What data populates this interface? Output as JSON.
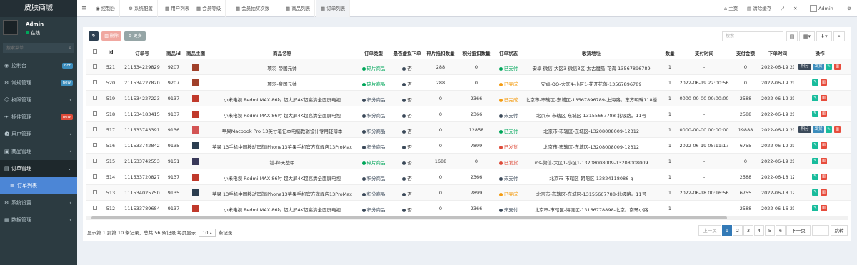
{
  "app": {
    "title": "皮肤商城"
  },
  "user": {
    "name": "Admin",
    "status": "在线"
  },
  "sidebar": {
    "search_placeholder": "搜索菜单",
    "items": [
      {
        "label": "控制台",
        "icon": "dashboard-icon",
        "badge": "hot",
        "badge_color": "#3c8dbc"
      },
      {
        "label": "常规管理",
        "icon": "cog-icon",
        "badge": "new",
        "badge_color": "#3c8dbc"
      },
      {
        "label": "权限管理",
        "icon": "users-icon",
        "arrow": "‹"
      },
      {
        "label": "插件管理",
        "icon": "rocket-icon",
        "badge": "new",
        "badge_color": "#dd4b39"
      },
      {
        "label": "用户管理",
        "icon": "user-icon",
        "arrow": "‹"
      },
      {
        "label": "商品管理",
        "icon": "goods-icon",
        "arrow": "‹"
      },
      {
        "label": "订单管理",
        "icon": "order-icon",
        "arrow": "⌄"
      },
      {
        "label": "订单列表",
        "icon": "list-icon"
      },
      {
        "label": "系统设置",
        "icon": "settings-icon",
        "arrow": "‹"
      },
      {
        "label": "数据管理",
        "icon": "database-icon",
        "arrow": "‹"
      }
    ]
  },
  "topbar": {
    "menu_icon": "≡",
    "tabs": [
      {
        "label": "控制台",
        "icon": "◉"
      },
      {
        "label": "系统配置",
        "icon": "⚙"
      },
      {
        "label": "用户列表",
        "icon": "▦"
      },
      {
        "label": "会员等级",
        "icon": "▦"
      },
      {
        "label": "会员抽奖次数",
        "icon": "▦"
      },
      {
        "label": "商品列表",
        "icon": "▦"
      },
      {
        "label": "订单列表",
        "icon": "▦"
      }
    ],
    "home": "主页",
    "clear_cache": "清除缓存",
    "admin": "Admin"
  },
  "toolbar": {
    "delete": "删除",
    "more": "更多",
    "search_placeholder": "搜索"
  },
  "columns": [
    "Id",
    "订单号",
    "商品id",
    "商品主图",
    "商品名称",
    "订单类型",
    "是否虚拟下单",
    "碎片抵扣数量",
    "积分抵扣数量",
    "订单状态",
    "收货地址",
    "数量",
    "支付时间",
    "支付金额",
    "下单时间",
    "操作"
  ],
  "rows": [
    {
      "id": "521",
      "order_no": "211534229829",
      "goods_id": "9207",
      "name": "项羽-帝国元帅",
      "type": "碎片商品",
      "type_color": "#00a65a",
      "virtual": "否",
      "frag": "288",
      "points": "0",
      "status": "已支付",
      "status_color": "#00a65a",
      "address": "安卓-微信-大区3-微信3区-太古魔岛-花海-13567896789",
      "qty": "1",
      "pay_time": "-",
      "amount": "0",
      "order_time": "2022-06-19 21",
      "pic_color": "#a0402a",
      "extra": true
    },
    {
      "id": "520",
      "order_no": "211534227820",
      "goods_id": "9207",
      "name": "项羽-帝国元帅",
      "type": "碎片商品",
      "type_color": "#00a65a",
      "virtual": "否",
      "frag": "288",
      "points": "0",
      "status": "已完成",
      "status_color": "#f39c12",
      "address": "安卓-QQ-大区4-小区1-花开花落-13567896789",
      "qty": "1",
      "pay_time": "2022-06-19 22:00:56",
      "amount": "0",
      "order_time": "2022-06-19 21",
      "pic_color": "#a0402a",
      "extra": false
    },
    {
      "id": "519",
      "order_no": "111534227223",
      "goods_id": "9137",
      "name": "小米电视 Redmi MAX 86吋 超大屏4K超高清全面屏电视",
      "type": "积分商品",
      "type_color": "#3c4a5a",
      "virtual": "否",
      "frag": "0",
      "points": "2366",
      "status": "已完成",
      "status_color": "#f39c12",
      "address": "北京市-市辖区-东城区-13567896789-上海路。东方明珠118楼",
      "qty": "1",
      "pay_time": "0000-00-00 00:00:00",
      "amount": "2588",
      "order_time": "2022-06-19 21",
      "pic_color": "#c0392b",
      "extra": false
    },
    {
      "id": "518",
      "order_no": "111534183415",
      "goods_id": "9137",
      "name": "小米电视 Redmi MAX 86吋 超大屏4K超高清全面屏电视",
      "type": "积分商品",
      "type_color": "#3c4a5a",
      "virtual": "否",
      "frag": "0",
      "points": "2366",
      "status": "未支付",
      "status_color": "#3c4a5a",
      "address": "北京市-市辖区-东城区-13155667788-北极路。11号",
      "qty": "1",
      "pay_time": "-",
      "amount": "2588",
      "order_time": "2022-06-19 21",
      "pic_color": "#c0392b",
      "extra": false
    },
    {
      "id": "517",
      "order_no": "111533743391",
      "goods_id": "9136",
      "name": "苹果Macbook Pro 13英寸笔记本电脑教辑设计专用轻薄本",
      "type": "积分商品",
      "type_color": "#3c4a5a",
      "virtual": "否",
      "frag": "0",
      "points": "12858",
      "status": "已支付",
      "status_color": "#00a65a",
      "address": "北京市-市辖区-东城区-13208008009-12312",
      "qty": "1",
      "pay_time": "0000-00-00 00:00:00",
      "amount": "19888",
      "order_time": "2022-06-19 21",
      "pic_color": "#d35454",
      "extra": true
    },
    {
      "id": "516",
      "order_no": "111533742842",
      "goods_id": "9135",
      "name": "苹果 13手机中国移动官旗iPhone13苹果手机官方旗舰店13ProMax",
      "type": "积分商品",
      "type_color": "#3c4a5a",
      "virtual": "否",
      "frag": "0",
      "points": "7899",
      "status": "已发货",
      "status_color": "#dd4b39",
      "address": "北京市-市辖区-东城区-13208008009-12312",
      "qty": "1",
      "pay_time": "2022-06-19 05:11:17",
      "amount": "6755",
      "order_time": "2022-06-19 21",
      "pic_color": "#2c3e50",
      "extra": false
    },
    {
      "id": "515",
      "order_no": "211533742553",
      "goods_id": "9151",
      "name": "铠-绛天战甲",
      "type": "碎片商品",
      "type_color": "#00a65a",
      "virtual": "否",
      "frag": "1688",
      "points": "0",
      "status": "已发货",
      "status_color": "#dd4b39",
      "address": "ios-微信-大区1-小区1-13208008009-13208008009",
      "qty": "1",
      "pay_time": "-",
      "amount": "0",
      "order_time": "2022-06-19 21",
      "pic_color": "#3a3a5a",
      "extra": false
    },
    {
      "id": "514",
      "order_no": "111533720827",
      "goods_id": "9137",
      "name": "小米电视 Redmi MAX 86吋 超大屏4K超高清全面屏电视",
      "type": "积分商品",
      "type_color": "#3c4a5a",
      "virtual": "否",
      "frag": "0",
      "points": "2366",
      "status": "未支付",
      "status_color": "#3c4a5a",
      "address": "北京市-市辖区-朝阳区-13824118086-q",
      "qty": "1",
      "pay_time": "-",
      "amount": "2588",
      "order_time": "2022-06-18 12",
      "pic_color": "#c0392b",
      "extra": false
    },
    {
      "id": "513",
      "order_no": "111534025750",
      "goods_id": "9135",
      "name": "苹果 13手机中国移动官旗iPhone13苹果手机官方旗舰店13ProMax",
      "type": "积分商品",
      "type_color": "#3c4a5a",
      "virtual": "否",
      "frag": "0",
      "points": "7899",
      "status": "已完成",
      "status_color": "#f39c12",
      "address": "北京市-市辖区-东城区-13155667788-北极路。11号",
      "qty": "1",
      "pay_time": "2022-06-18 00:16:56",
      "amount": "6755",
      "order_time": "2022-06-18 12",
      "pic_color": "#2c3e50",
      "extra": false
    },
    {
      "id": "512",
      "order_no": "111533789684",
      "goods_id": "9137",
      "name": "小米电视 Redmi MAX 86吋 超大屏4K超高清全面屏电视",
      "type": "积分商品",
      "type_color": "#3c4a5a",
      "virtual": "否",
      "frag": "0",
      "points": "2366",
      "status": "未支付",
      "status_color": "#3c4a5a",
      "address": "北京市-市辖区-海淀区-13166778898-北京。南环小路",
      "qty": "1",
      "pay_time": "-",
      "amount": "2588",
      "order_time": "2022-06-16 21",
      "pic_color": "#c0392b",
      "extra": false
    }
  ],
  "row_actions": {
    "ship": "发货",
    "pay": "发货",
    "extra": "积分"
  },
  "footer": {
    "summary_pre": "显示第 1 到第 10 条记录，总共 56 条记录 每页显示",
    "per_page": "10",
    "summary_post": "条记录"
  },
  "pagination": {
    "prev": "上一页",
    "pages": [
      "1",
      "2",
      "3",
      "4",
      "5",
      "6"
    ],
    "next": "下一页",
    "jump": "跳转"
  }
}
